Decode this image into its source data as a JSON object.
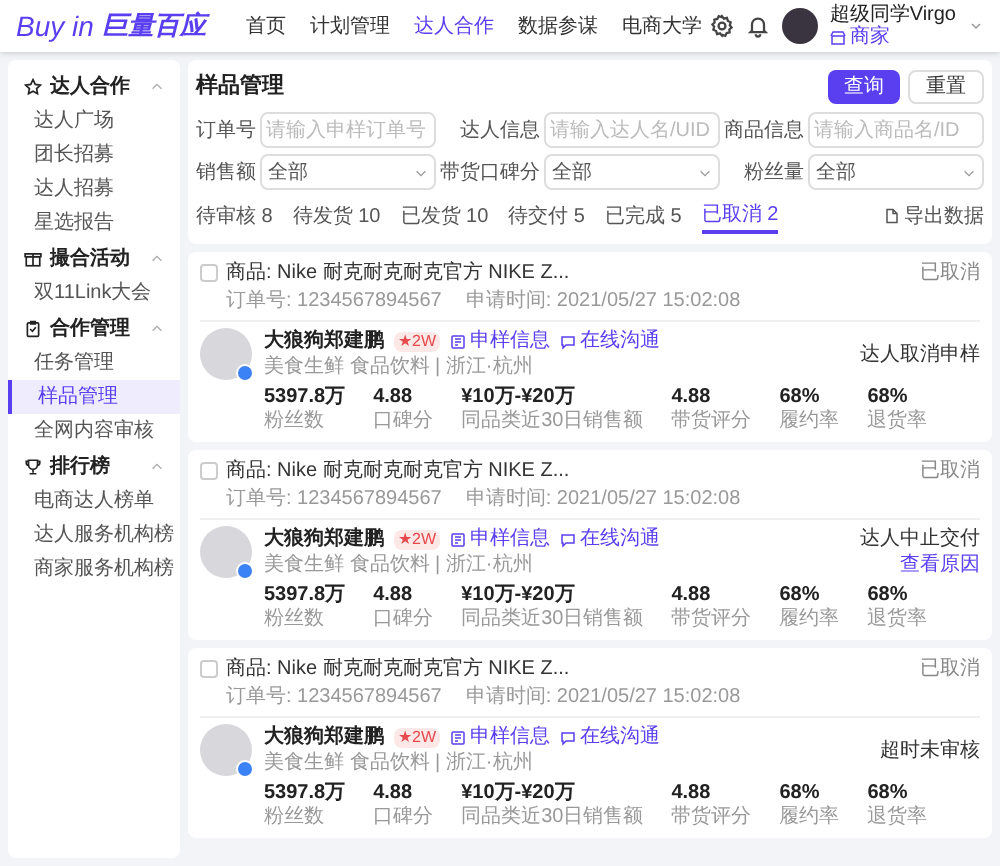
{
  "top_nav": {
    "logo": "Buy in",
    "logo_cn": "巨量百应",
    "menu": [
      {
        "label": "首页",
        "selected": false
      },
      {
        "label": "计划管理",
        "selected": false
      },
      {
        "label": "达人合作",
        "selected": true
      },
      {
        "label": "数据参谋",
        "selected": false
      },
      {
        "label": "电商大学",
        "selected": false
      }
    ],
    "user": {
      "name": "超级同学Virgo",
      "role": "商家"
    }
  },
  "sidebar": {
    "groups": [
      {
        "title": "达人合作",
        "expanded": true,
        "items": [
          {
            "label": "达人广场",
            "selected": false
          },
          {
            "label": "团长招募",
            "selected": false
          },
          {
            "label": "达人招募",
            "selected": false
          },
          {
            "label": "星选报告",
            "selected": false
          }
        ]
      },
      {
        "title": "撮合活动",
        "expanded": true,
        "items": [
          {
            "label": "双11Link大会",
            "selected": false
          }
        ]
      },
      {
        "title": "合作管理",
        "expanded": true,
        "items": [
          {
            "label": "任务管理",
            "selected": false
          },
          {
            "label": "样品管理",
            "selected": true
          },
          {
            "label": "全网内容审核",
            "selected": false
          }
        ]
      },
      {
        "title": "排行榜",
        "expanded": true,
        "items": [
          {
            "label": "电商达人榜单",
            "selected": false
          },
          {
            "label": "达人服务机构榜",
            "selected": false
          },
          {
            "label": "商家服务机构榜",
            "selected": false
          }
        ]
      }
    ]
  },
  "filters": {
    "title": "样品管理",
    "fields": [
      {
        "kind": "text",
        "label": "订单号",
        "placeholder": "请输入申样订单号"
      },
      {
        "kind": "text",
        "label": "达人信息",
        "placeholder": "请输入达人名/UID"
      },
      {
        "kind": "text",
        "label": "商品信息",
        "placeholder": "请输入商品名/ID"
      },
      {
        "kind": "select",
        "label": "销售额",
        "value": "全部"
      },
      {
        "kind": "select",
        "label": "带货口碑分",
        "value": "全部"
      },
      {
        "kind": "select",
        "label": "粉丝量",
        "value": "全部"
      }
    ],
    "buttons": [
      {
        "kind": "primary",
        "label": "查询"
      },
      {
        "kind": "default",
        "label": "重置"
      }
    ]
  },
  "tabs": [
    {
      "label": "待审核 8",
      "selected": false
    },
    {
      "label": "待发货 10",
      "selected": false
    },
    {
      "label": "已发货 10",
      "selected": false
    },
    {
      "label": "待交付 5",
      "selected": false
    },
    {
      "label": "已完成 5",
      "selected": false
    },
    {
      "label": "已取消 2",
      "selected": true
    }
  ],
  "export": "导出数据",
  "orders": [
    {
      "checked": false,
      "product": "商品: Nike 耐克耐克耐克官方 NIKE Z...",
      "order_no": "订单号: 1234567894567",
      "time": "申请时间: 2021/05/27 15:02:08",
      "status": "已取消",
      "creator": {
        "name": "大狼狗郑建鹏",
        "badge": "★2W",
        "tags": "美食生鲜 食品饮料 | 浙江·杭州",
        "links": [
          "申样信息",
          "在线沟通"
        ]
      },
      "stats": [
        {
          "value": "5397.8万",
          "label": "粉丝数"
        },
        {
          "value": "4.88",
          "label": "口碑分"
        },
        {
          "value": "¥10万-¥20万",
          "label": "同品类近30日销售额"
        },
        {
          "value": "4.88",
          "label": "带货评分"
        },
        {
          "value": "68%",
          "label": "履约率"
        },
        {
          "value": "68%",
          "label": "退货率"
        }
      ],
      "result": "达人取消申样"
    },
    {
      "checked": false,
      "product": "商品: Nike 耐克耐克耐克官方 NIKE Z...",
      "order_no": "订单号: 1234567894567",
      "time": "申请时间: 2021/05/27 15:02:08",
      "status": "已取消",
      "creator": {
        "name": "大狼狗郑建鹏",
        "badge": "★2W",
        "tags": "美食生鲜 食品饮料 | 浙江·杭州",
        "links": [
          "申样信息",
          "在线沟通"
        ]
      },
      "stats": [
        {
          "value": "5397.8万",
          "label": "粉丝数"
        },
        {
          "value": "4.88",
          "label": "口碑分"
        },
        {
          "value": "¥10万-¥20万",
          "label": "同品类近30日销售额"
        },
        {
          "value": "4.88",
          "label": "带货评分"
        },
        {
          "value": "68%",
          "label": "履约率"
        },
        {
          "value": "68%",
          "label": "退货率"
        }
      ],
      "result": "达人中止交付",
      "result_link": "查看原因"
    },
    {
      "checked": false,
      "product": "商品: Nike 耐克耐克耐克官方 NIKE Z...",
      "order_no": "订单号: 1234567894567",
      "time": "申请时间: 2021/05/27 15:02:08",
      "status": "已取消",
      "creator": {
        "name": "大狼狗郑建鹏",
        "badge": "★2W",
        "tags": "美食生鲜 食品饮料 | 浙江·杭州",
        "links": [
          "申样信息",
          "在线沟通"
        ]
      },
      "stats": [
        {
          "value": "5397.8万",
          "label": "粉丝数"
        },
        {
          "value": "4.88",
          "label": "口碑分"
        },
        {
          "value": "¥10万-¥20万",
          "label": "同品类近30日销售额"
        },
        {
          "value": "4.88",
          "label": "带货评分"
        },
        {
          "value": "68%",
          "label": "履约率"
        },
        {
          "value": "68%",
          "label": "退货率"
        }
      ],
      "result": "超时未审核"
    }
  ]
}
